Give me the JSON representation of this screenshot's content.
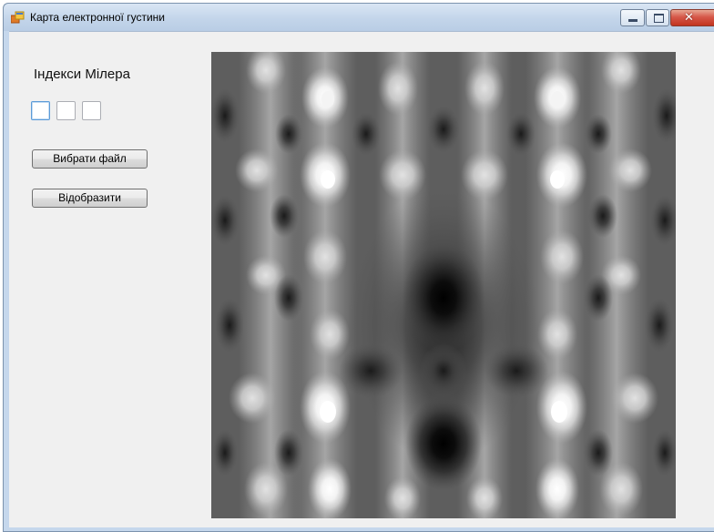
{
  "window": {
    "title": "Карта електронної густини",
    "icon": "app-window-icon",
    "controls": {
      "minimize": "minimize-icon",
      "maximize": "maximize-icon",
      "close": "close-icon"
    }
  },
  "form": {
    "miller_label": "Індекси Мілера",
    "miller_indices": [
      "",
      "",
      ""
    ],
    "choose_file_button": "Вибрати файл",
    "display_button": "Відобразити"
  },
  "density_map": {
    "colormap": "grayscale",
    "dark_color": "#000000",
    "light_color": "#ffffff"
  }
}
